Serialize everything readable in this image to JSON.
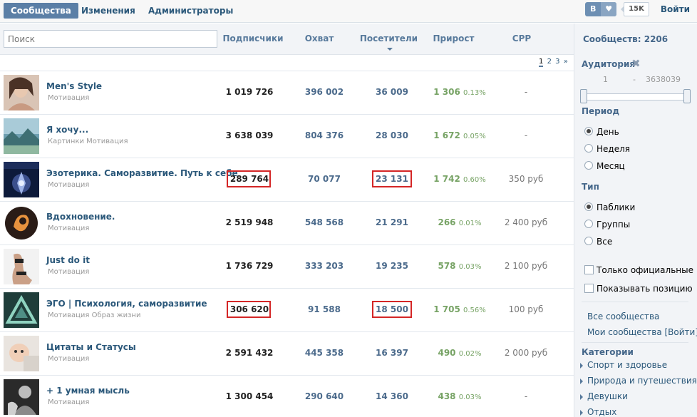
{
  "topbar": {
    "tabs": [
      "Сообщества",
      "Изменения",
      "Администраторы"
    ],
    "share_letter": "B",
    "share_heart": "♥",
    "share_count": "15K",
    "login": "Войти"
  },
  "header": {
    "search_placeholder": "Поиск",
    "columns": [
      "Подписчики",
      "Охват",
      "Посетители",
      "Прирост",
      "CPP"
    ]
  },
  "pager": [
    "1",
    "2",
    "3",
    "»"
  ],
  "rows": [
    {
      "name": "Men's Style",
      "category": "Мотивация",
      "subscribers": "1 019 726",
      "reach": "396 002",
      "visitors": "36 009",
      "growth": "1 306",
      "growth_pct": "0.13%",
      "cpp": "-"
    },
    {
      "name": "Я хочу...",
      "category": "Картинки Мотивация",
      "subscribers": "3 638 039",
      "reach": "804 376",
      "visitors": "28 030",
      "growth": "1 672",
      "growth_pct": "0.05%",
      "cpp": "-"
    },
    {
      "name": "Эзотерика. Саморазвитие. Путь к себе",
      "category": "Мотивация",
      "subscribers": "289 764",
      "reach": "70 077",
      "visitors": "23 131",
      "growth": "1 742",
      "growth_pct": "0.60%",
      "cpp": "350 руб"
    },
    {
      "name": "Вдохновение.",
      "category": "Мотивация",
      "subscribers": "2 519 948",
      "reach": "548 568",
      "visitors": "21 291",
      "growth": "266",
      "growth_pct": "0.01%",
      "cpp": "2 400 руб"
    },
    {
      "name": "Just do it",
      "category": "Мотивация",
      "subscribers": "1 736 729",
      "reach": "333 203",
      "visitors": "19 235",
      "growth": "578",
      "growth_pct": "0.03%",
      "cpp": "2 100 руб"
    },
    {
      "name": "ЭГО | Психология, саморазвитие",
      "category": "Мотивация Образ жизни",
      "subscribers": "306 620",
      "reach": "91 588",
      "visitors": "18 500",
      "growth": "1 705",
      "growth_pct": "0.56%",
      "cpp": "100 руб"
    },
    {
      "name": "Цитаты и Статусы",
      "category": "Мотивация",
      "subscribers": "2 591 432",
      "reach": "445 358",
      "visitors": "16 397",
      "growth": "490",
      "growth_pct": "0.02%",
      "cpp": "2 000 руб"
    },
    {
      "name": "+ 1 умная мысль",
      "category": "Мотивация",
      "subscribers": "1 300 454",
      "reach": "290 640",
      "visitors": "14 360",
      "growth": "438",
      "growth_pct": "0.03%",
      "cpp": "-"
    }
  ],
  "sidebar": {
    "count": "Сообществ: 2206",
    "audience_label": "Аудитория",
    "audience_min": "1",
    "audience_dash": "-",
    "audience_max": "3638039",
    "period_label": "Период",
    "period_options": [
      "День",
      "Неделя",
      "Месяц"
    ],
    "type_label": "Тип",
    "type_options": [
      "Паблики",
      "Группы",
      "Все"
    ],
    "only_official": "Только официальные",
    "show_position": "Показывать позицию",
    "all_communities": "Все сообщества",
    "my_communities": "Мои сообщества [Войти]",
    "categories_label": "Категории",
    "categories": [
      "Спорт и здоровье",
      "Природа и путешествия",
      "Девушки",
      "Отдых"
    ]
  }
}
